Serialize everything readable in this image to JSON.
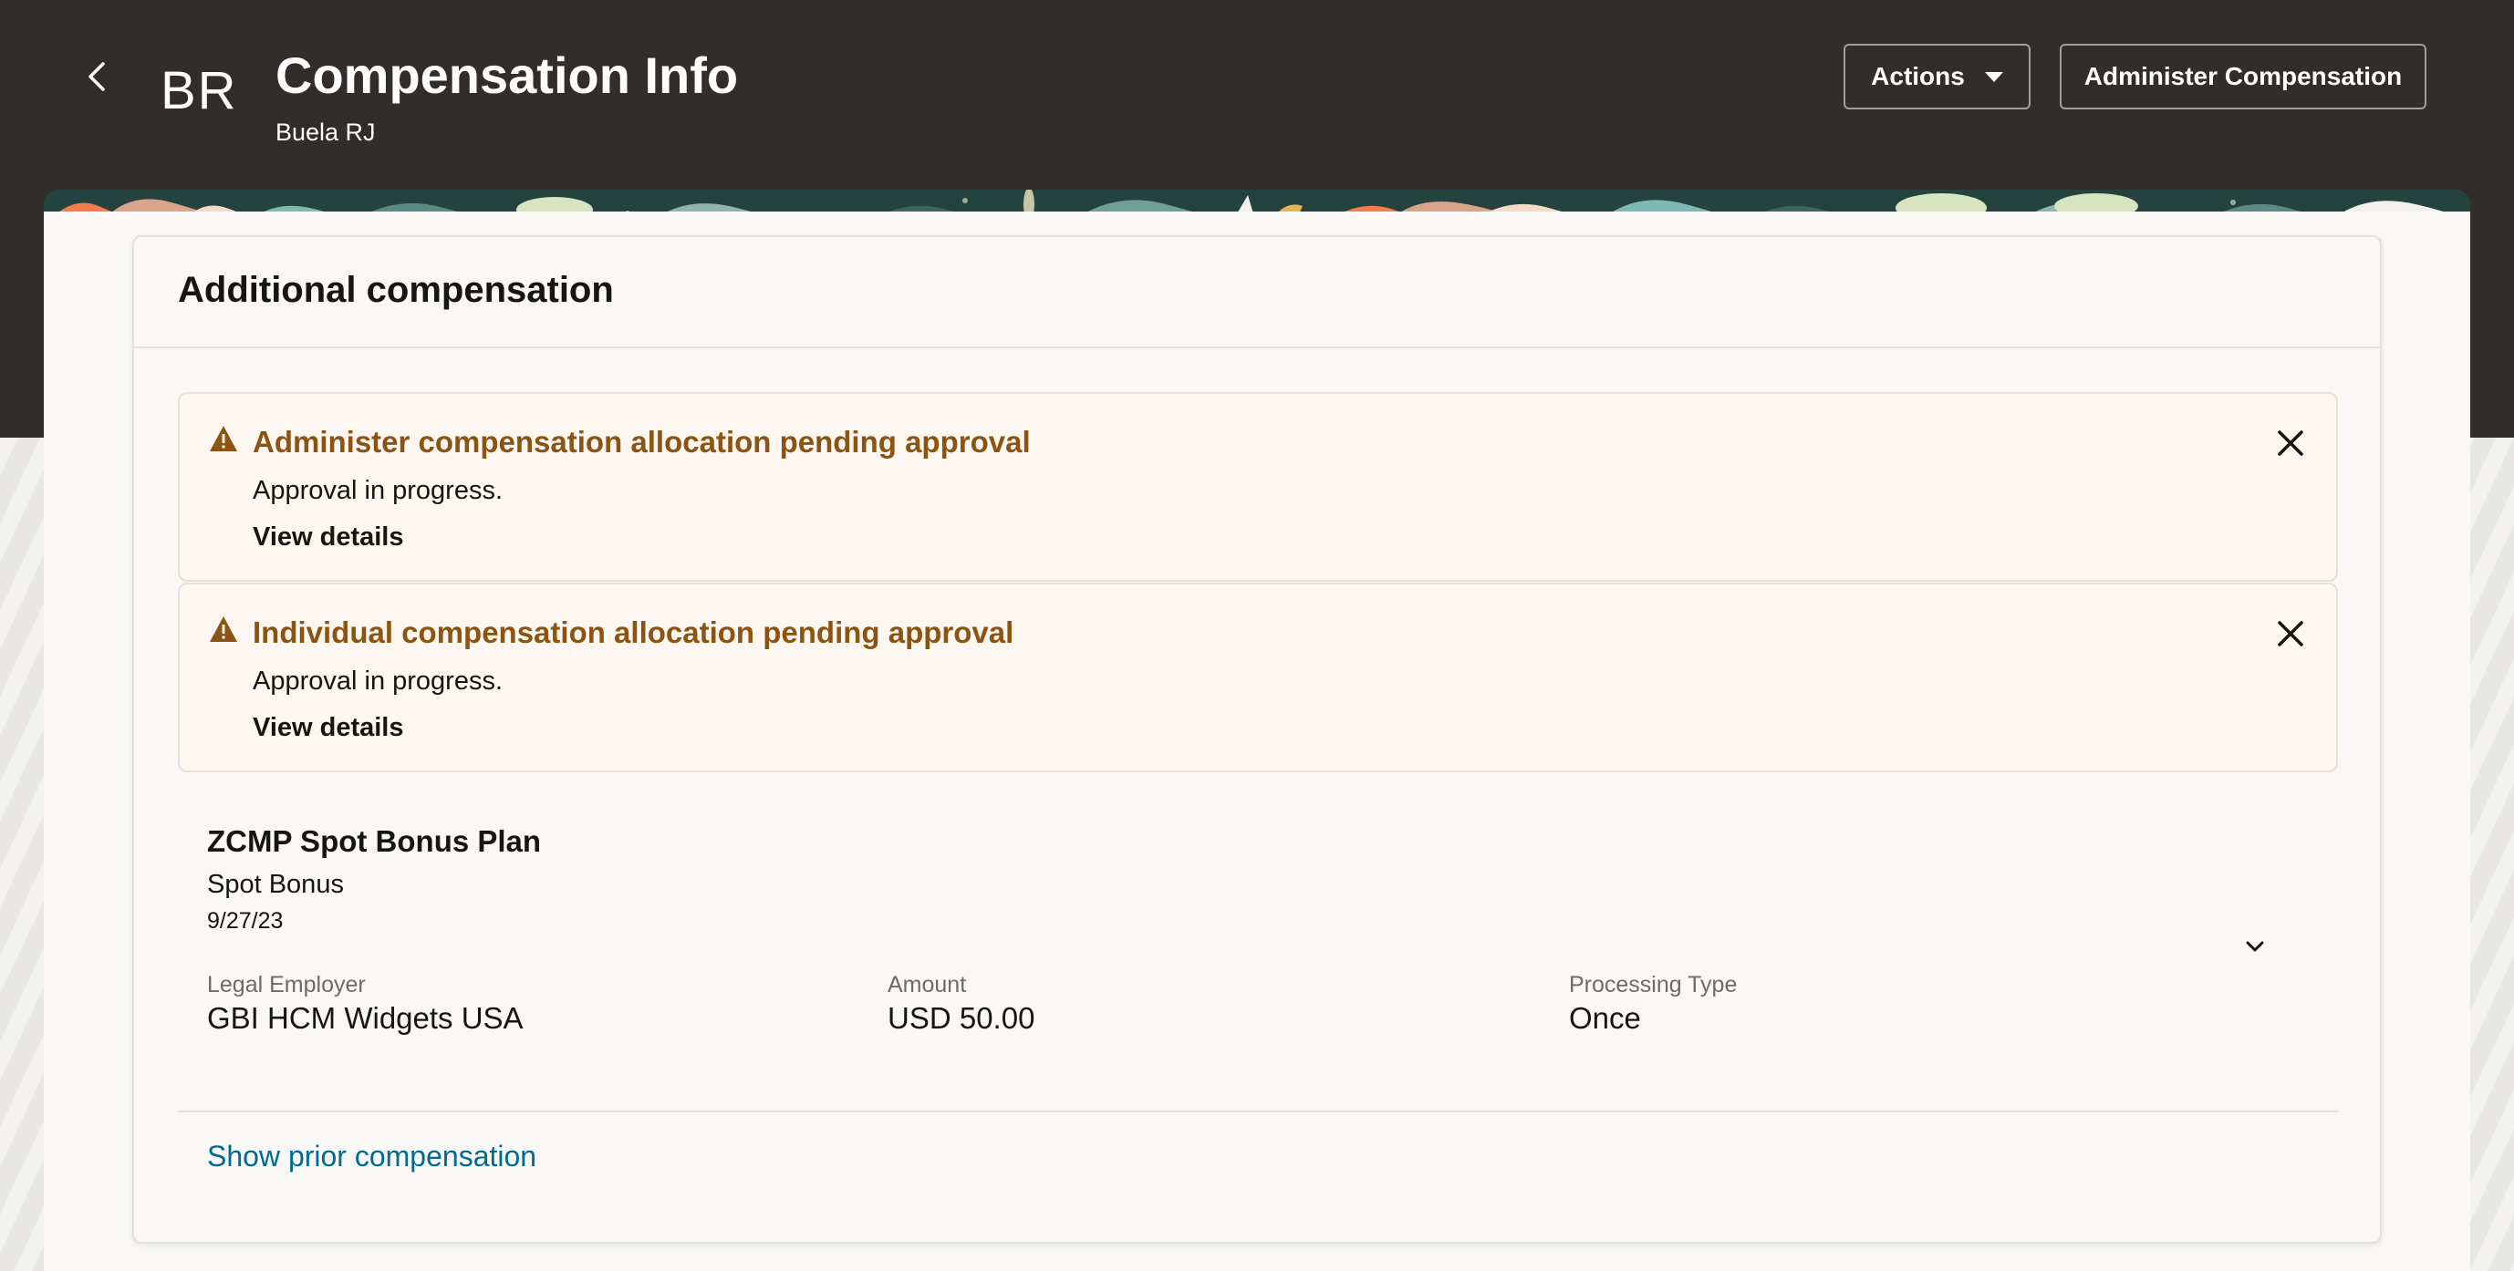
{
  "header": {
    "back_icon": "chevron-left-icon",
    "initials": "BR",
    "title": "Compensation Info",
    "subtitle": "Buela RJ",
    "actions_label": "Actions",
    "administer_label": "Administer Compensation"
  },
  "card": {
    "title": "Additional compensation",
    "alerts": [
      {
        "title": "Administer compensation allocation pending approval",
        "message": "Approval in progress.",
        "link": "View details",
        "icon": "warning-icon"
      },
      {
        "title": "Individual compensation allocation pending approval",
        "message": "Approval in progress.",
        "link": "View details",
        "icon": "warning-icon"
      }
    ],
    "plan": {
      "name": "ZCMP Spot Bonus Plan",
      "type": "Spot Bonus",
      "date": "9/27/23",
      "fields": [
        {
          "label": "Legal Employer",
          "value": "GBI HCM Widgets USA"
        },
        {
          "label": "Amount",
          "value": "USD 50.00"
        },
        {
          "label": "Processing Type",
          "value": "Once"
        }
      ]
    },
    "show_prior_label": "Show prior compensation"
  },
  "colors": {
    "header_bg": "#312d2a",
    "warning_text": "#8c5412",
    "link": "#006b8f"
  }
}
